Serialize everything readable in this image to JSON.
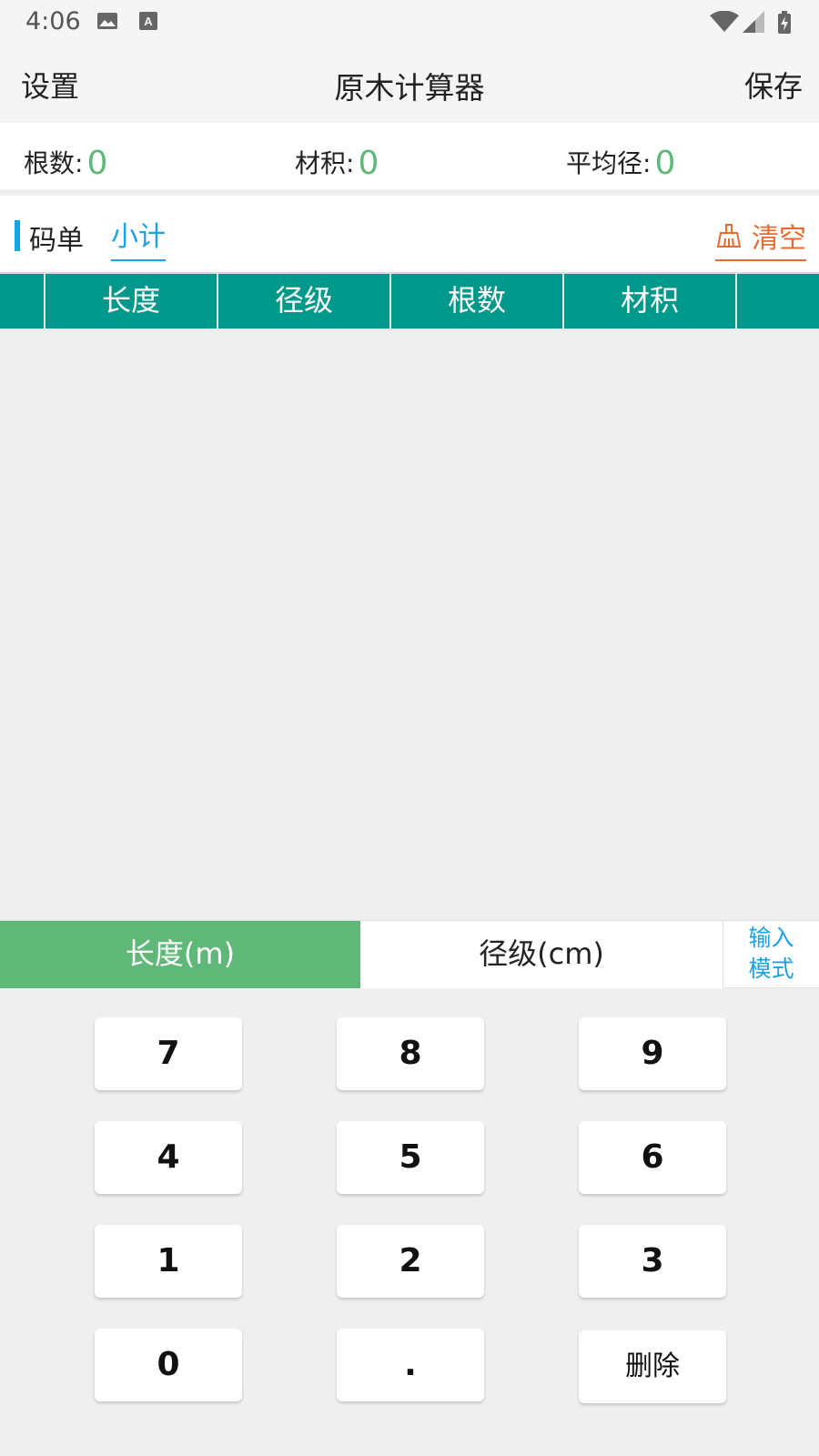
{
  "status_bar": {
    "time": "4:06"
  },
  "app_bar": {
    "left_label": "设置",
    "title": "原木计算器",
    "right_label": "保存"
  },
  "summary": {
    "count_label": "根数:",
    "count_value": "0",
    "volume_label": "材积:",
    "volume_value": "0",
    "avg_diameter_label": "平均径:",
    "avg_diameter_value": "0"
  },
  "tabs": {
    "main": "码单",
    "sub": "小计",
    "clear_label": "清空"
  },
  "table": {
    "columns": [
      "长度",
      "径级",
      "根数",
      "材积"
    ]
  },
  "input_mode": {
    "length": "长度(m)",
    "diameter": "径级(cm)",
    "mode_line1": "输入",
    "mode_line2": "模式"
  },
  "keypad": {
    "keys": [
      "7",
      "8",
      "9",
      "4",
      "5",
      "6",
      "1",
      "2",
      "3",
      "0",
      ".",
      "删除"
    ]
  },
  "colors": {
    "accent_green": "#5fb878",
    "table_teal": "#00988a",
    "link_blue": "#1aa1e6",
    "clear_orange": "#e86a2e"
  }
}
